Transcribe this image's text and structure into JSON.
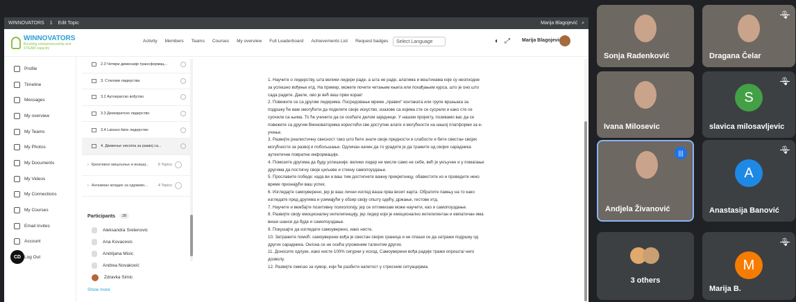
{
  "browser": {
    "app": "WINNOVATORS",
    "counter": "1",
    "edit": "Edit Topic",
    "user": "Marija Blagojević"
  },
  "header": {
    "brand": "WINNOVATORS",
    "tagline": "Boosting entrepreneurship and STEAM capacity",
    "nav": [
      "Activity",
      "Members",
      "Teams",
      "Courses",
      "My overview",
      "Full Leaderboard",
      "Achievements List",
      "Request badges"
    ],
    "language": "Select Language",
    "user": "Marija Blagojević"
  },
  "sidebar": [
    {
      "label": "Profile",
      "icon": "person-icon"
    },
    {
      "label": "Timeline",
      "icon": "timeline-icon"
    },
    {
      "label": "Messages",
      "icon": "messages-icon"
    },
    {
      "label": "My overview",
      "icon": "overview-icon"
    },
    {
      "label": "My Teams",
      "icon": "teams-icon"
    },
    {
      "label": "My Photos",
      "icon": "photos-icon"
    },
    {
      "label": "My Documents",
      "icon": "documents-icon"
    },
    {
      "label": "My Videos",
      "icon": "videos-icon"
    },
    {
      "label": "My Connections",
      "icon": "connections-icon"
    },
    {
      "label": "My Courses",
      "icon": "courses-icon"
    },
    {
      "label": "Email Invites",
      "icon": "email-icon"
    },
    {
      "label": "Account",
      "icon": "account-icon"
    },
    {
      "label": "Log Out",
      "icon": "logout-icon"
    }
  ],
  "bottom_badge": "CD",
  "lessons": [
    "2.3 Четири димензије трансформац...",
    "3. Стилови лидерства",
    "3.2 Аутократско вођство",
    "3.3 Демократско лидерство",
    "3.4 Laissez-faire лидерство",
    "4. Движење ниcoma за развој ca..."
  ],
  "sections": [
    {
      "title": "Креативно мишљење и инициј...",
      "count": "5 Topics"
    },
    {
      "title": "Ангажман младих за одрживо...",
      "count": "4 Topics"
    }
  ],
  "participants": {
    "title": "Participants",
    "count": "28",
    "list": [
      "Aleksandra Sretenovic",
      "Ana Kovacevic",
      "Andrijana Misic",
      "Andrea Novaković",
      "Zdravka Simic"
    ],
    "show_more": "Show more"
  },
  "content": [
    "1. Научите о лидерству, шта велики лидери раде, а шта не раде, алатима и вештинама које су неопходне за успешно вођење итд. На пример, можете почети читањем књига или похађањем курса, што је оно што сада радите. Дакле, ово је већ ваш први корак!",
    "2. Повежите се са другим лидерима. Посредовање мреже „правих“ контаката или групе вршњака за подршку ће вам омогућити да поделите своје искуство, изазове са којима сте се сусрели и како сте се суочили са њима. То ће учинити да се осећате делом заједнице. У нашем пројекту, позивамо вас да се повежете са другим Винноваторима користећи све доступне алате и могућности на нашој платформи за е-учење.",
    "3. Развијте реалистичну свесност тако што ћете знати своје предности и слабости и бити свестан својих могућности за развој и побољшање. Одличан начин да то урадите је да тражите од својих сарадника аутентичне повратне информације.",
    "4. Помозите другима да буду успешније: велики лидер не мисли само не себе, већ је укључен и у помагање другима да постигну своје циљеве и стекну самопоуздање.",
    "5. Прославите победе: када ви и ваш тим достигнете важну прекретницу, обавестите из и проведите неко време признајући ваш успех.",
    "6. Изгледајте самоуверено, јер је ваш лични изглед ваша прва визит карта. Обратите пажњу на то како изгледате пред другима и узимајући у обзир своју општу одећу, држање, гестове итд.",
    "7. Научите и вежбајте позитивну психологију, јер се оптимизам може научити, као и самопоуздање.",
    "8. Развијте своју емоционалну интелигенцију, јер лидер који је емоционално интелигентан и емпатичан има више шанси да буде и самопоуздање.",
    "9. Покушајте да изгледате самоуверено, иако нисте.",
    "10. Затражите помоћ: самоуверени вођа је свестан својих граница и не плаши се да затражи подршку од других сарадника. Он/она се не осећа угроженим талентом других.",
    "11. Доносите одлуке, иако нисте 100% сигурни у исход. Самоуверени вођа радије тражи опрошта/ него дозволу.",
    "12. Развијте смисао за хумор, који ће разбити напетост у стресним ситуацијама."
  ],
  "tiles": [
    {
      "name": "Sonja Radenković",
      "type": "video",
      "muted": false
    },
    {
      "name": "Dragana Čelar",
      "type": "video",
      "muted": true
    },
    {
      "name": "Ivana Milosevic",
      "type": "video",
      "muted": false
    },
    {
      "name": "slavica milosavljevic",
      "type": "avatar",
      "letter": "S",
      "color": "#43a047",
      "muted": true
    },
    {
      "name": "Andjela Živanović",
      "type": "video",
      "muted": false,
      "speaking": true
    },
    {
      "name": "Anastasija Banović",
      "type": "avatar",
      "letter": "A",
      "color": "#1e88e5",
      "muted": true
    },
    {
      "name": "3 others",
      "type": "others",
      "muted": false
    },
    {
      "name": "Marija B.",
      "type": "avatar",
      "letter": "M",
      "color": "#f57c00",
      "muted": true
    }
  ]
}
